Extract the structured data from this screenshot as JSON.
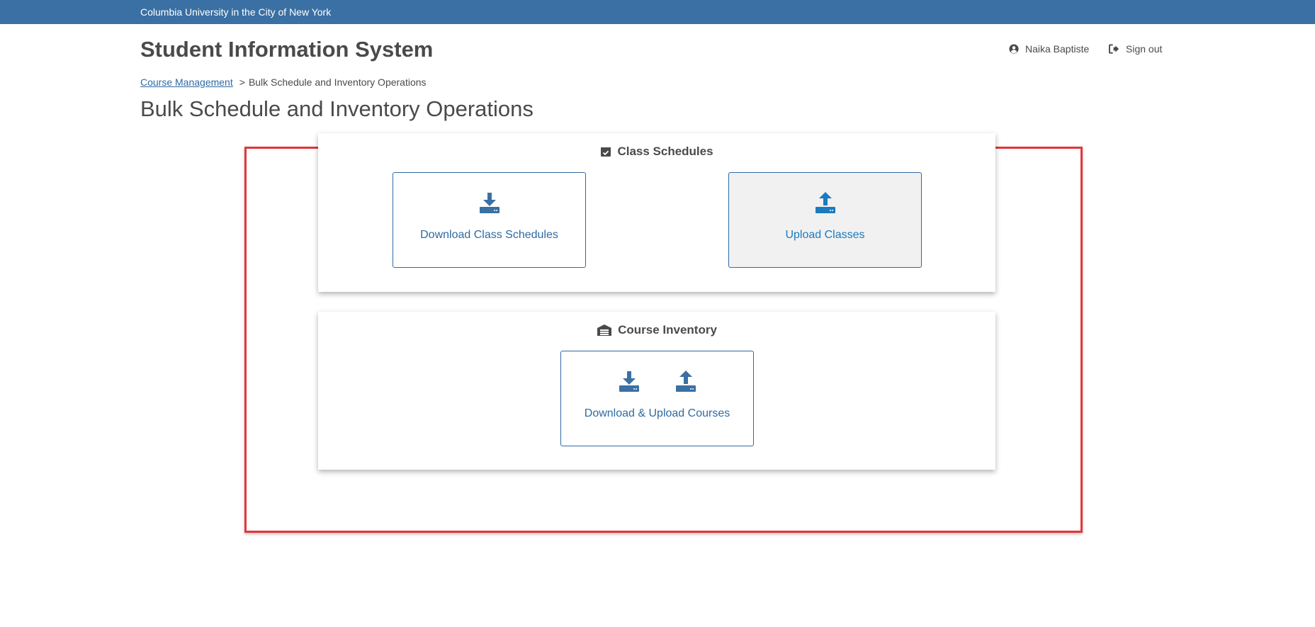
{
  "topbar": {
    "university": "Columbia University in the City of New York"
  },
  "header": {
    "site_title": "Student Information System",
    "user_name": "Naika Baptiste",
    "sign_out": "Sign out"
  },
  "breadcrumb": {
    "parent": "Course Management",
    "separator": ">",
    "current": "Bulk Schedule and Inventory Operations"
  },
  "page_title": "Bulk Schedule and Inventory Operations",
  "sections": {
    "class_schedules": {
      "title": "Class Schedules",
      "icon": "calendar-check-icon",
      "download_label": "Download Class Schedules",
      "upload_label": "Upload Classes"
    },
    "course_inventory": {
      "title": "Course Inventory",
      "icon": "warehouse-icon",
      "combined_label": "Download & Upload Courses"
    }
  },
  "colors": {
    "topbar": "#3a70a3",
    "link": "#2f6aa3",
    "upload_icon": "#1a7bc0",
    "highlight": "#e5353a",
    "text": "#4a4a4a"
  }
}
